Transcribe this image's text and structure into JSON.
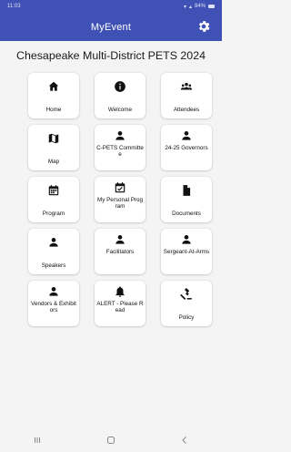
{
  "status_bar": {
    "time": "11:03",
    "battery_text": "84%"
  },
  "app_bar": {
    "title": "MyEvent"
  },
  "event_title": "Chesapeake Multi-District PETS 2024",
  "tiles": [
    {
      "label": "Home",
      "icon": "home-icon"
    },
    {
      "label": "Welcome",
      "icon": "info-icon"
    },
    {
      "label": "Attendees",
      "icon": "people-icon"
    },
    {
      "label": "Map",
      "icon": "map-icon"
    },
    {
      "label": "C-PETS Committee",
      "icon": "person-icon"
    },
    {
      "label": "24-25 Governors",
      "icon": "person-icon"
    },
    {
      "label": "Program",
      "icon": "calendar-icon"
    },
    {
      "label": "My Personal Program",
      "icon": "calendar-check-icon"
    },
    {
      "label": "Documents",
      "icon": "document-icon"
    },
    {
      "label": "Speakers",
      "icon": "person-icon"
    },
    {
      "label": "Facilitators",
      "icon": "person-icon"
    },
    {
      "label": "Sergeant-At-Arms",
      "icon": "person-icon"
    },
    {
      "label": "Vendors & Exhibitors",
      "icon": "person-icon"
    },
    {
      "label": "ALERT - Please Read",
      "icon": "bell-icon"
    },
    {
      "label": "Policy",
      "icon": "gavel-icon"
    }
  ],
  "colors": {
    "app_bar": "#3f51b5",
    "background": "#f4f4f4",
    "tile": "#ffffff",
    "icon": "#111111"
  }
}
